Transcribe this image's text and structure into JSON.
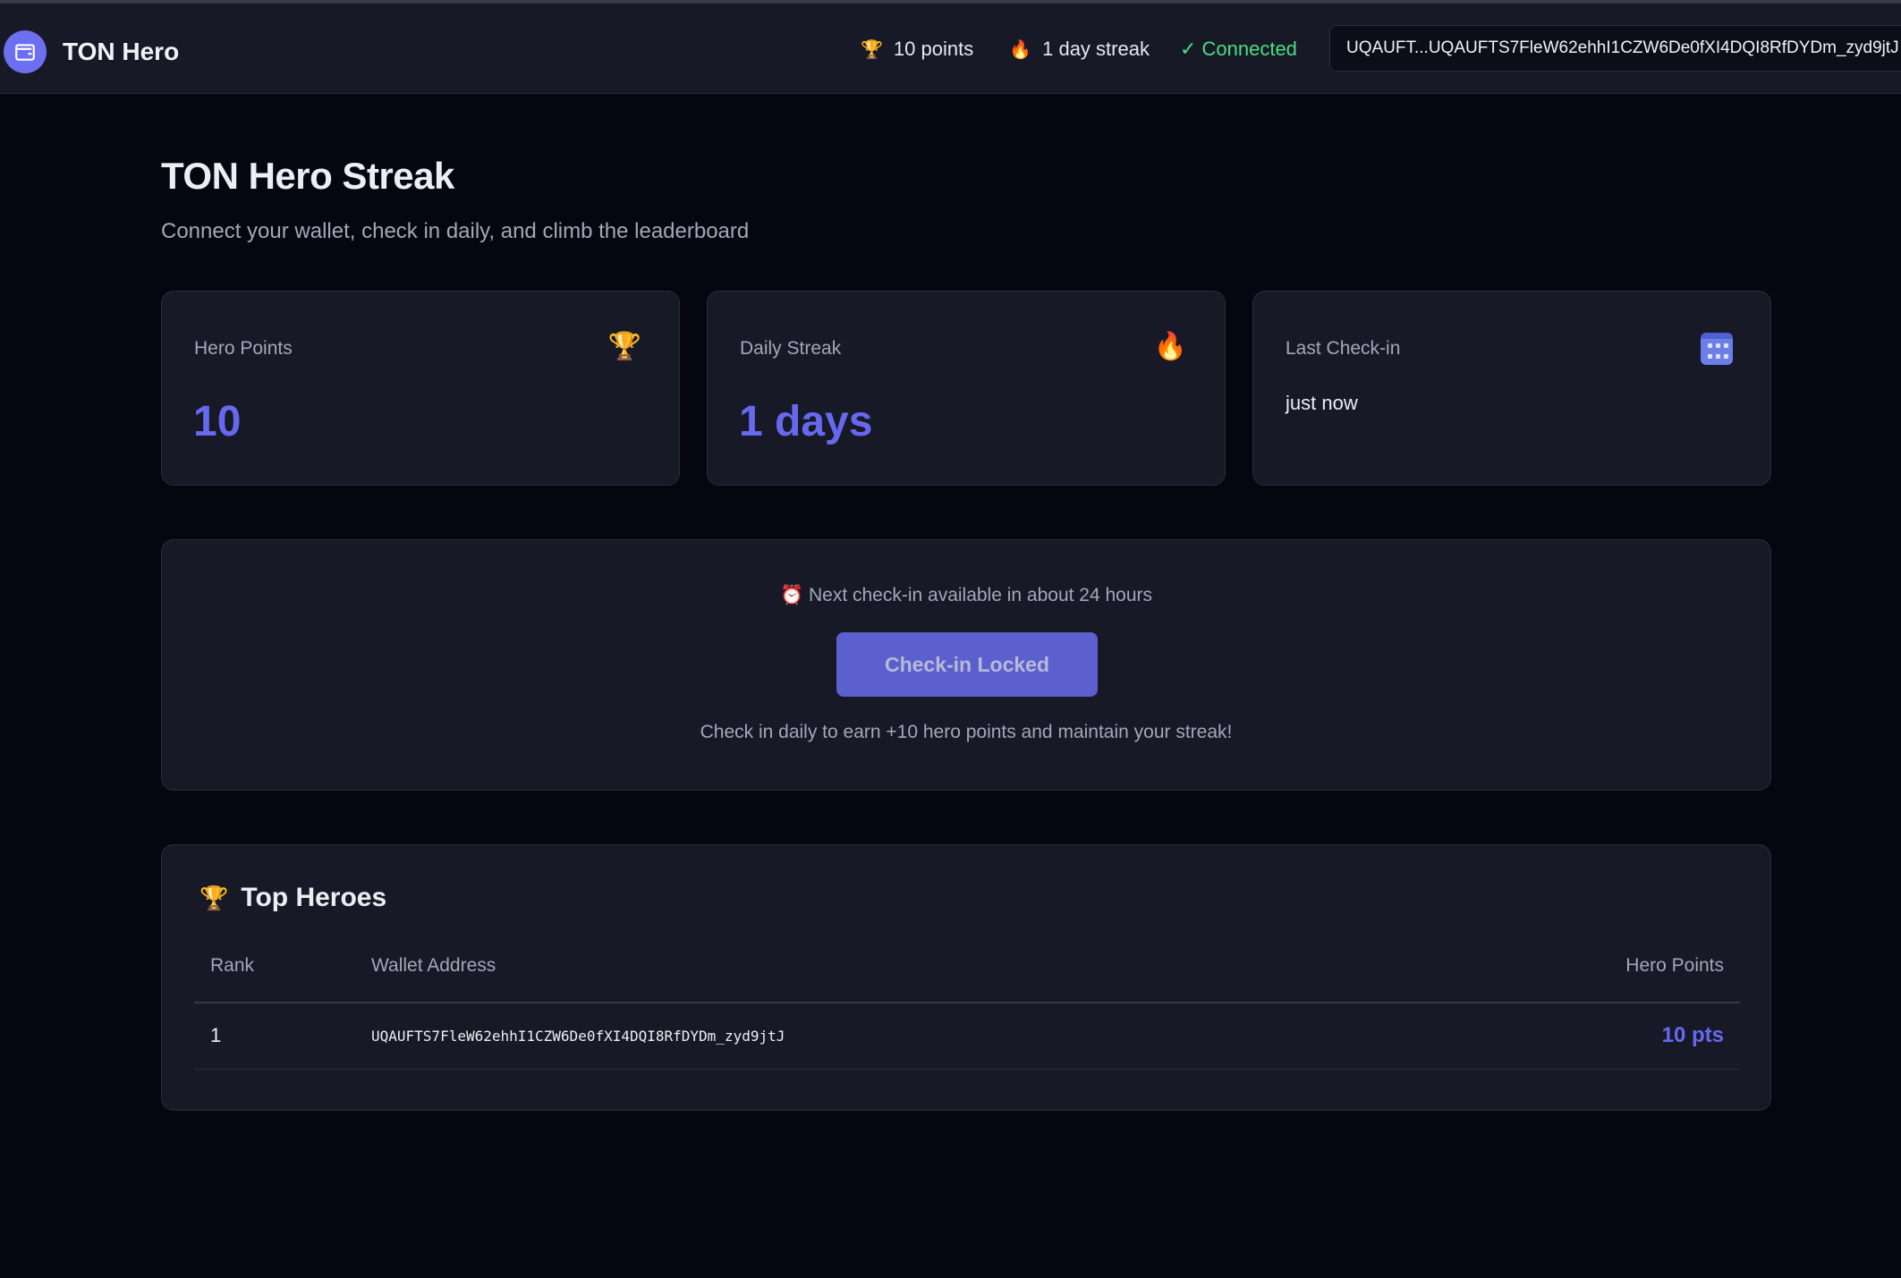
{
  "header": {
    "app_title": "TON Hero",
    "logo_icon": "wallet-icon",
    "points": "10 points",
    "streak": "1 day streak",
    "status": "✓ Connected",
    "wallet": "UQAUFT...UQAUFTS7FleW62ehhI1CZW6De0fXI4DQI8RfDYDm_zyd9jtJ"
  },
  "page": {
    "title": "TON Hero Streak",
    "subtitle": "Connect your wallet, check in daily, and climb the leaderboard"
  },
  "stats": [
    {
      "label": "Hero Points",
      "value": "10",
      "icon": "trophy-icon"
    },
    {
      "label": "Daily Streak",
      "value": "1 days",
      "icon": "fire-icon"
    },
    {
      "label": "Last Check-in",
      "value": "just now",
      "icon": "calendar-icon"
    }
  ],
  "checkin": {
    "next_message": "Next check-in available in about 24 hours",
    "button_label": "Check-in Locked",
    "tip": "Check in daily to earn +10 hero points and maintain your streak!"
  },
  "leaderboard": {
    "title": "Top Heroes",
    "columns": [
      "Rank",
      "Wallet Address",
      "Hero Points"
    ],
    "rows": [
      {
        "rank": "1",
        "address": "UQAUFTS7FleW62ehhI1CZW6De0fXI4DQI8RfDYDm_zyd9jtJ",
        "points": "10 pts"
      }
    ]
  },
  "colors": {
    "accent": "#6669ef",
    "connected": "#4ade80",
    "background": "#05060f",
    "card": "#181927"
  }
}
